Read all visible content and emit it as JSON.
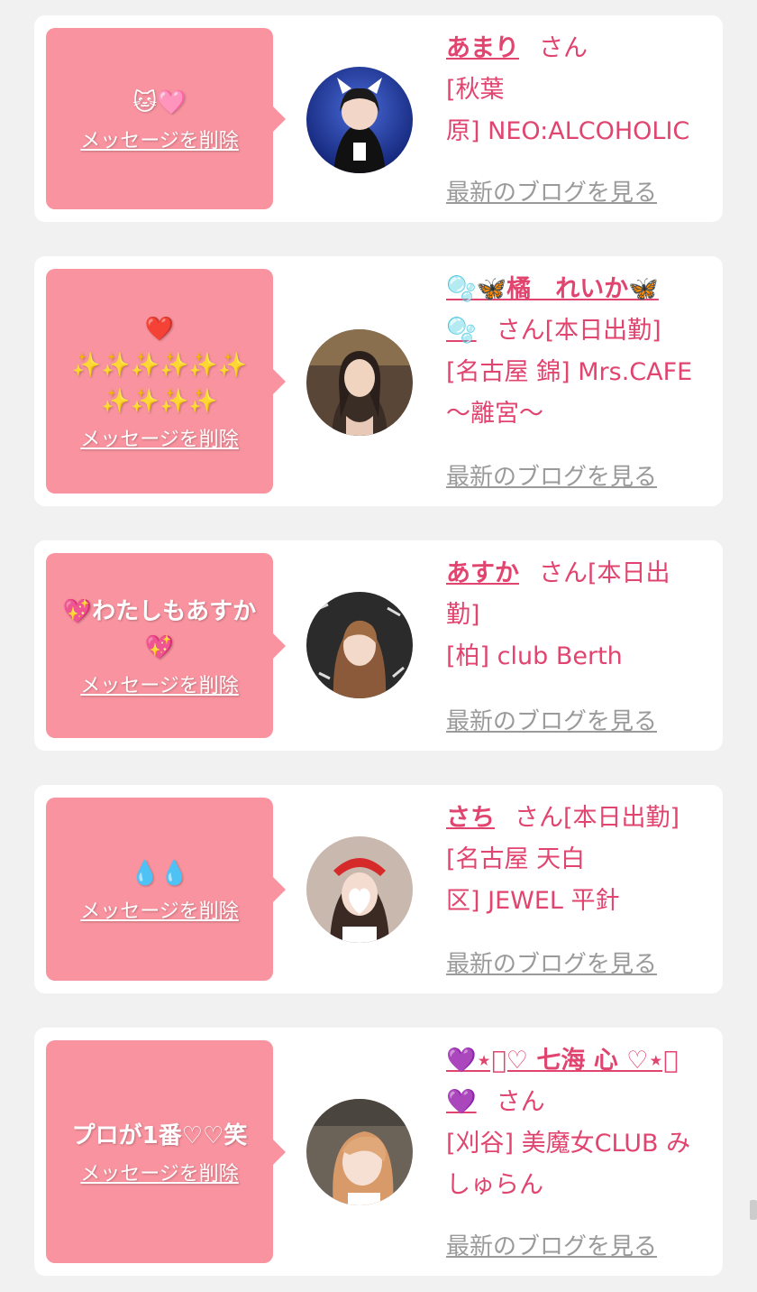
{
  "colors": {
    "accent": "#e0446f",
    "bubble": "#f8939f",
    "muted": "#9a9a9a"
  },
  "delete_label": "メッセージを削除",
  "blog_label": "最新のブログを見る",
  "san_label": "さん",
  "entries": [
    {
      "message_lines": [
        "🐱🩷"
      ],
      "name": "あまり",
      "suffix": "",
      "shop_lines": [
        "[秋葉",
        "原] NEO:ALCOHOLIC"
      ]
    },
    {
      "message_lines": [
        "❤️",
        "✨✨✨✨✨✨",
        "✨✨✨✨"
      ],
      "name_lines": [
        "🫧🦋橘　れいか🦋",
        "🫧"
      ],
      "suffix": "[本日出勤]",
      "shop_lines": [
        "[名古屋 錦] Mrs.CAFE",
        "〜離宮〜"
      ]
    },
    {
      "message_lines": [
        "💖わたしもあすか",
        "💖"
      ],
      "name": "あすか",
      "suffix": "[本日出",
      "suffix_line2": "勤]",
      "shop_lines": [
        "[柏] club Berth"
      ]
    },
    {
      "message_lines": [
        "💧💧"
      ],
      "name": "さち",
      "suffix": "[本日出勤]",
      "shop_lines": [
        "[名古屋 天白",
        "区] JEWEL 平針"
      ]
    },
    {
      "message_lines": [
        "プロが1番♡♡笑"
      ],
      "name_lines": [
        "💜⋆͛♡ 七海 心 ♡⋆͛",
        "💜"
      ],
      "suffix": "",
      "shop_lines": [
        "[刈谷] 美魔女CLUB み",
        "しゅらん"
      ]
    }
  ]
}
